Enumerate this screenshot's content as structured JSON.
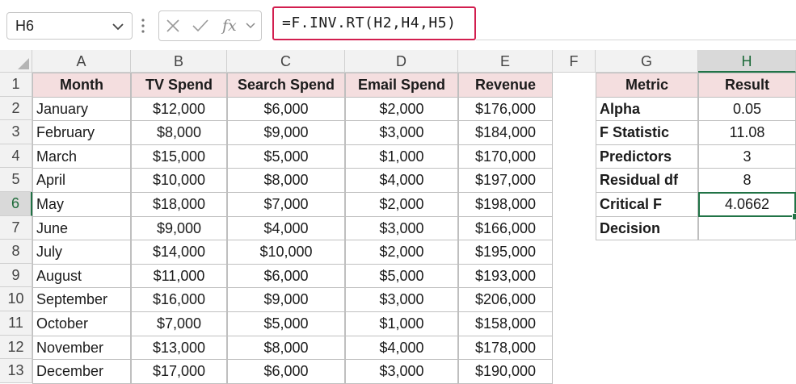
{
  "formula_bar": {
    "name_box": "H6",
    "formula": "=F.INV.RT(H2,H4,H5)"
  },
  "columns": [
    "A",
    "B",
    "C",
    "D",
    "E",
    "F",
    "G",
    "H"
  ],
  "rows": [
    "1",
    "2",
    "3",
    "4",
    "5",
    "6",
    "7",
    "8",
    "9",
    "10",
    "11",
    "12",
    "13"
  ],
  "main_table": {
    "headers": [
      "Month",
      "TV Spend",
      "Search Spend",
      "Email Spend",
      "Revenue"
    ],
    "rows": [
      [
        "January",
        "$12,000",
        "$6,000",
        "$2,000",
        "$176,000"
      ],
      [
        "February",
        "$8,000",
        "$9,000",
        "$3,000",
        "$184,000"
      ],
      [
        "March",
        "$15,000",
        "$5,000",
        "$1,000",
        "$170,000"
      ],
      [
        "April",
        "$10,000",
        "$8,000",
        "$4,000",
        "$197,000"
      ],
      [
        "May",
        "$18,000",
        "$7,000",
        "$2,000",
        "$198,000"
      ],
      [
        "June",
        "$9,000",
        "$4,000",
        "$3,000",
        "$166,000"
      ],
      [
        "July",
        "$14,000",
        "$10,000",
        "$2,000",
        "$195,000"
      ],
      [
        "August",
        "$11,000",
        "$6,000",
        "$5,000",
        "$193,000"
      ],
      [
        "September",
        "$16,000",
        "$9,000",
        "$3,000",
        "$206,000"
      ],
      [
        "October",
        "$7,000",
        "$5,000",
        "$1,000",
        "$158,000"
      ],
      [
        "November",
        "$13,000",
        "$8,000",
        "$4,000",
        "$178,000"
      ],
      [
        "December",
        "$17,000",
        "$6,000",
        "$3,000",
        "$190,000"
      ]
    ]
  },
  "results_table": {
    "headers": [
      "Metric",
      "Result"
    ],
    "rows": [
      [
        "Alpha",
        "0.05"
      ],
      [
        "F Statistic",
        "11.08"
      ],
      [
        "Predictors",
        "3"
      ],
      [
        "Residual df",
        "8"
      ],
      [
        "Critical F",
        "4.0662"
      ],
      [
        "Decision",
        ""
      ]
    ]
  },
  "selected_cell": "H6",
  "colors": {
    "header_fill": "#f4dedf",
    "selection": "#217346",
    "formula_highlight": "#d21e4f"
  },
  "icons": [
    "chevron-down-icon",
    "cancel-x-icon",
    "enter-check-icon",
    "function-fx-icon"
  ]
}
